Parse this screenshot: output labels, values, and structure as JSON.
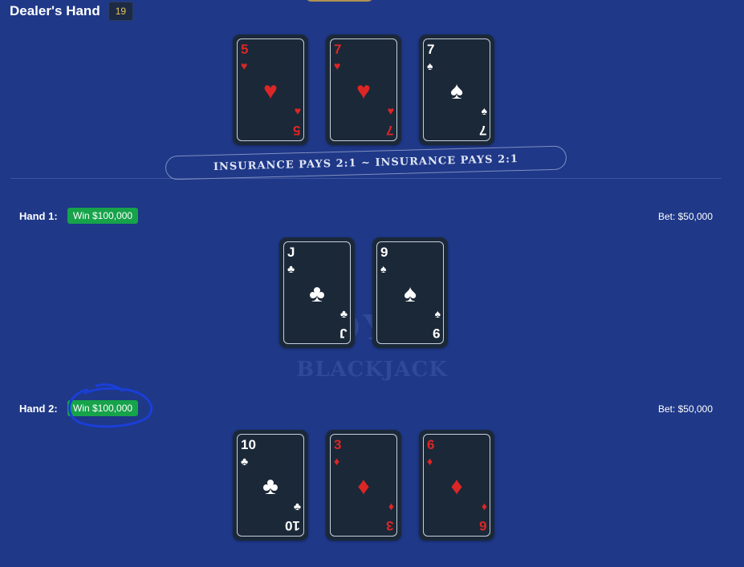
{
  "dealer": {
    "title": "Dealer's Hand",
    "score": "19",
    "cards": [
      {
        "rank": "5",
        "suit": "♥",
        "color": "red"
      },
      {
        "rank": "7",
        "suit": "♥",
        "color": "red"
      },
      {
        "rank": "7",
        "suit": "♠",
        "color": "white"
      }
    ]
  },
  "insurance_text": "INSURANCE PAYS 2:1 ~ INSURANCE PAYS 2:1",
  "watermark": {
    "top": "ROYAL",
    "bottom": "BLACKJACK"
  },
  "hands": [
    {
      "label": "Hand 1:",
      "result": "Win $100,000",
      "bet": "Bet: $50,000",
      "cards": [
        {
          "rank": "J",
          "suit": "♣",
          "color": "white"
        },
        {
          "rank": "9",
          "suit": "♠",
          "color": "white"
        }
      ]
    },
    {
      "label": "Hand 2:",
      "result": "Win $100,000",
      "bet": "Bet: $50,000",
      "cards": [
        {
          "rank": "10",
          "suit": "♣",
          "color": "white"
        },
        {
          "rank": "3",
          "suit": "♦",
          "color": "red"
        },
        {
          "rank": "6",
          "suit": "♦",
          "color": "red"
        }
      ]
    }
  ],
  "colors": {
    "felt": "#1f3888",
    "card": "#1b2838",
    "red_suit": "#dc2626",
    "win_badge": "#16a34a",
    "score_text": "#e7c35a",
    "annotation": "#1a3fd6"
  }
}
